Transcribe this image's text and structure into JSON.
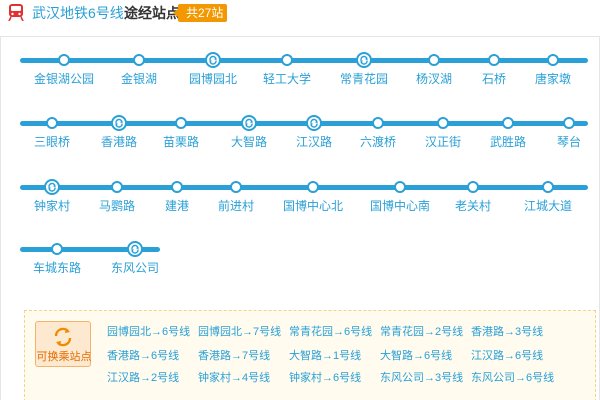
{
  "header": {
    "icon": "metro-train-icon",
    "line_name": "武汉地铁6号线",
    "route_label": "途经站点",
    "count": "共27站"
  },
  "colors": {
    "line": "#2aa0d6",
    "badge": "#f39800",
    "transfer_text": "#e36c00"
  },
  "rows": [
    {
      "stations": [
        {
          "name": "金银湖公园",
          "transfer": false
        },
        {
          "name": "金银湖",
          "transfer": false
        },
        {
          "name": "园博园北",
          "transfer": true
        },
        {
          "name": "轻工大学",
          "transfer": false
        },
        {
          "name": "常青花园",
          "transfer": true
        },
        {
          "name": "杨汊湖",
          "transfer": false
        },
        {
          "name": "石桥",
          "transfer": false
        },
        {
          "name": "唐家墩",
          "transfer": false
        }
      ]
    },
    {
      "stations": [
        {
          "name": "三眼桥",
          "transfer": false
        },
        {
          "name": "香港路",
          "transfer": true
        },
        {
          "name": "苗栗路",
          "transfer": false
        },
        {
          "name": "大智路",
          "transfer": true
        },
        {
          "name": "江汉路",
          "transfer": true
        },
        {
          "name": "六渡桥",
          "transfer": false
        },
        {
          "name": "汉正街",
          "transfer": false
        },
        {
          "name": "武胜路",
          "transfer": false
        },
        {
          "name": "琴台",
          "transfer": false
        }
      ]
    },
    {
      "stations": [
        {
          "name": "钟家村",
          "transfer": true
        },
        {
          "name": "马鹦路",
          "transfer": false
        },
        {
          "name": "建港",
          "transfer": false
        },
        {
          "name": "前进村",
          "transfer": false
        },
        {
          "name": "国博中心北",
          "transfer": false
        },
        {
          "name": "国博中心南",
          "transfer": false
        },
        {
          "name": "老关村",
          "transfer": false
        },
        {
          "name": "江城大道",
          "transfer": false
        }
      ]
    },
    {
      "stations": [
        {
          "name": "车城东路",
          "transfer": false
        },
        {
          "name": "东风公司",
          "transfer": true
        }
      ]
    }
  ],
  "transfer_section": {
    "button_label": "可换乘站点",
    "icon": "swap-arrows-icon",
    "items": [
      "园博园北→6号线",
      "园博园北→7号线",
      "常青花园→6号线",
      "常青花园→2号线",
      "香港路→3号线",
      "香港路→6号线",
      "香港路→7号线",
      "大智路→1号线",
      "大智路→6号线",
      "江汉路→6号线",
      "江汉路→2号线",
      "钟家村→4号线",
      "钟家村→6号线",
      "东风公司→3号线",
      "东风公司→6号线"
    ]
  }
}
